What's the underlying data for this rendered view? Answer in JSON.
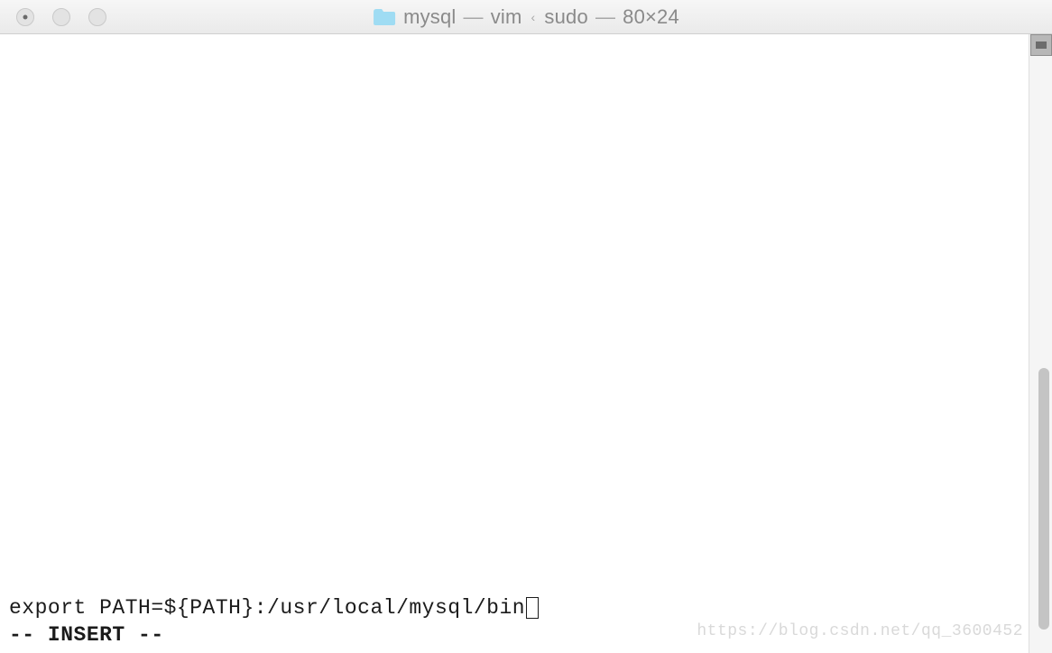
{
  "titlebar": {
    "folder": "mysql",
    "separator1": "—",
    "process1": "vim",
    "sub_caret": "‹",
    "process2": "sudo",
    "separator2": "—",
    "dimensions": "80×24"
  },
  "terminal": {
    "export_line": "export PATH=${PATH}:/usr/local/mysql/bin",
    "mode_line": "-- INSERT --"
  },
  "watermark": "https://blog.csdn.net/qq_3600452"
}
